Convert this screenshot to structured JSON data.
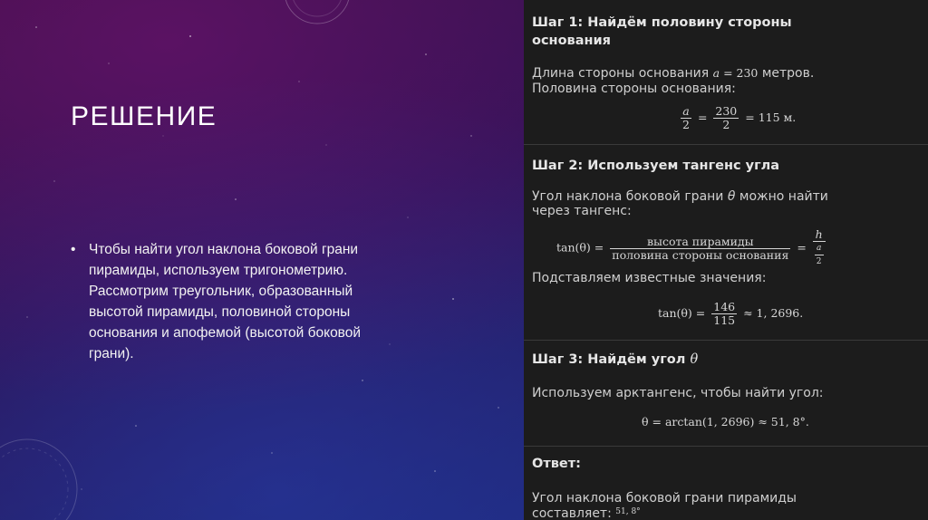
{
  "slide": {
    "title": "РЕШЕНИЕ",
    "bullet_marker": "•",
    "bullet_text": "Чтобы найти угол наклона боковой грани пирамиды, используем тригонометрию. Рассмотрим треугольник, образованный высотой пирамиды, половиной стороны основания и апофемой (высотой боковой грани)."
  },
  "panel": {
    "step1": {
      "title_line1": "Шаг 1: Найдём половину стороны",
      "title_line2": "основания",
      "text_line1_prefix": "Длина стороны основания ",
      "var_a": "a",
      "eq_230": "= 230",
      "text_line1_suffix": " метров.",
      "text_line2": "Половина стороны основания:",
      "f1_num": "a",
      "f1_den": "2",
      "eq": "=",
      "f2_num": "230",
      "f2_den": "2",
      "result": "= 115 м."
    },
    "step2": {
      "title": "Шаг 2: Используем тангенс угла",
      "text_line1_prefix": "Угол наклона боковой грани ",
      "theta": "θ",
      "text_line1_suffix": " можно найти",
      "text_line2": "через тангенс:",
      "tan_lhs": "tan(θ) =",
      "frac_num": "высота пирамиды",
      "frac_den": "половина стороны основания",
      "eq2": "=",
      "h_num": "h",
      "h_den_num": "a",
      "h_den_den": "2",
      "subst_text": "Подставляем известные значения:",
      "tan_lhs2": "tan(θ) =",
      "num_146": "146",
      "den_115": "115",
      "approx_result": "≈ 1, 2696."
    },
    "step3": {
      "title_prefix": "Шаг 3: Найдём угол ",
      "theta": "θ",
      "text": "Используем арктангенс, чтобы найти угол:",
      "formula": "θ = arctan(1, 2696) ≈ 51, 8°."
    },
    "answer": {
      "title": "Ответ:",
      "text_line1": "Угол наклона боковой грани пирамиды",
      "text_line2": "составляет:",
      "value": "51, 8°"
    }
  }
}
